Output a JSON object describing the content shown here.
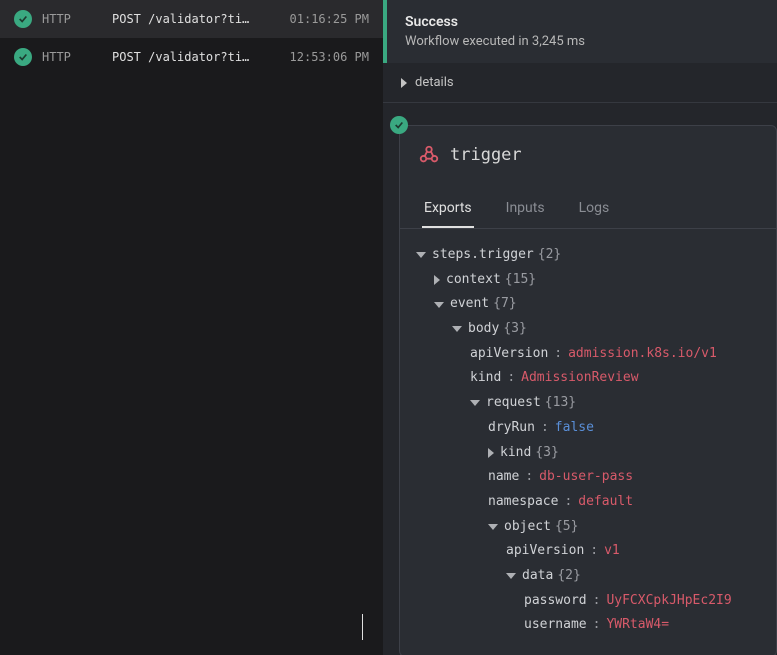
{
  "logs": [
    {
      "method": "HTTP",
      "path": "POST /validator?ti…",
      "time": "01:16:25 PM"
    },
    {
      "method": "HTTP",
      "path": "POST /validator?ti…",
      "time": "12:53:06 PM"
    }
  ],
  "success": {
    "title": "Success",
    "subtitle": "Workflow executed in 3,245 ms"
  },
  "details_label": "details",
  "trigger": {
    "title": "trigger",
    "tabs": {
      "exports": "Exports",
      "inputs": "Inputs",
      "logs": "Logs"
    }
  },
  "tree": {
    "root": "steps.trigger",
    "root_count": "{2}",
    "context": "context",
    "context_count": "{15}",
    "event": "event",
    "event_count": "{7}",
    "body": "body",
    "body_count": "{3}",
    "apiVersion_k": "apiVersion",
    "apiVersion_v": "admission.k8s.io/v1",
    "kind_k": "kind",
    "kind_v": "AdmissionReview",
    "request": "request",
    "request_count": "{13}",
    "dryRun_k": "dryRun",
    "dryRun_v": "false",
    "rkind": "kind",
    "rkind_count": "{3}",
    "name_k": "name",
    "name_v": "db-user-pass",
    "namespace_k": "namespace",
    "namespace_v": "default",
    "object": "object",
    "object_count": "{5}",
    "oapiVersion_k": "apiVersion",
    "oapiVersion_v": "v1",
    "data": "data",
    "data_count": "{2}",
    "password_k": "password",
    "password_v": "UyFCXCpkJHpEc2I9",
    "username_k": "username",
    "username_v": "YWRtaW4="
  }
}
